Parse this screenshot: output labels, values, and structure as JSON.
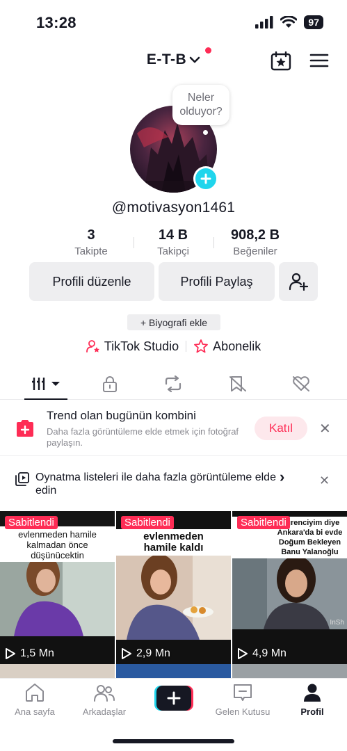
{
  "status": {
    "time": "13:28",
    "battery": "97"
  },
  "header": {
    "account_name": "E-T-B"
  },
  "bubble": {
    "text": "Neler olduyor?"
  },
  "profile": {
    "username": "@motivasyon1461"
  },
  "stats": [
    {
      "value": "3",
      "label": "Takipte"
    },
    {
      "value": "14 B",
      "label": "Takipçi"
    },
    {
      "value": "908,2 B",
      "label": "Beğeniler"
    }
  ],
  "actions": {
    "edit": "Profili düzenle",
    "share": "Profili Paylaş"
  },
  "bio": {
    "add": "+ Biyografi ekle"
  },
  "links": {
    "studio": "TikTok Studio",
    "subscription": "Abonelik"
  },
  "banner1": {
    "title": "Trend olan bugünün kombini",
    "subtitle": "Daha fazla görüntüleme elde etmek için fotoğraf paylaşın.",
    "join": "Katıl"
  },
  "banner2": {
    "text": "Oynatma listeleri ile daha fazla görüntüleme elde edin",
    "arrow": "›"
  },
  "videos": [
    {
      "pinned": "Sabitlendi",
      "caption": "evlenmeden hamile kalmadan önce düşünücektin",
      "views": "1,5 Mn"
    },
    {
      "pinned": "Sabitlendi",
      "caption": "evlenmeden hamile kaldı",
      "views": "2,9 Mn"
    },
    {
      "pinned": "Sabitlendi",
      "caption": "Öğrenciyim diye Ankara'da bi evde Doğum Bekleyen Banu Yalanoğlu",
      "views": "4,9 Mn"
    }
  ],
  "watermark": "InSh",
  "bottom_nav": [
    {
      "label": "Ana sayfa"
    },
    {
      "label": "Arkadaşlar"
    },
    {
      "label": "Gelen Kutusu"
    },
    {
      "label": "Profil"
    }
  ],
  "colors": {
    "accent": "#fe2c55",
    "cyan": "#20d5ec",
    "text": "#161823",
    "muted": "#8a8a91"
  }
}
